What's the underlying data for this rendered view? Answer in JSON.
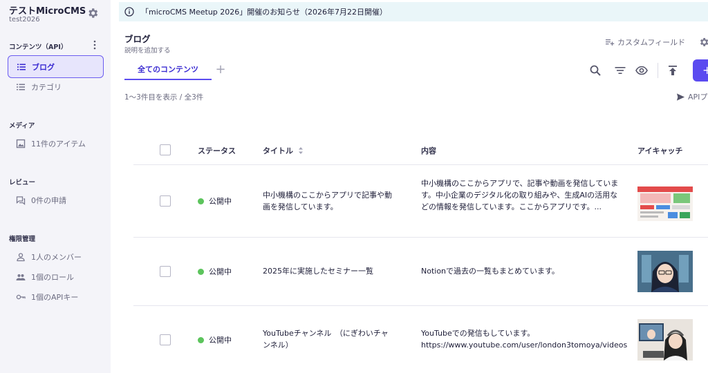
{
  "sidebar": {
    "app_name": "テストMicroCMS",
    "app_id": "test2026",
    "sections": {
      "contents": "コンテンツ（API）",
      "media": "メディア",
      "review": "レビュー",
      "permissions": "権限管理"
    },
    "items": {
      "blog": "ブログ",
      "category": "カテゴリ",
      "media": "11件のアイテム",
      "review": "0件の申請",
      "members": "1人のメンバー",
      "roles": "1個のロール",
      "api_keys": "1個のAPIキー"
    }
  },
  "banner": {
    "text": "「microCMS Meetup 2026」開催のお知らせ（2026年7月22日開催）"
  },
  "header": {
    "title": "ブログ",
    "description": "説明を追加する",
    "custom_field": "カスタムフィールド",
    "tab": "全てのコンテンツ",
    "tab_add": "+",
    "add_button": "+"
  },
  "list": {
    "count": "1〜3件目を表示 / 全3件",
    "api_preview": "APIプ",
    "columns": {
      "status": "ステータス",
      "title": "タイトル",
      "content": "内容",
      "eyecatch": "アイキャッチ"
    },
    "rows": [
      {
        "status": "公開中",
        "title": "中小機構のここからアプリで記事や動画を発信しています。",
        "content": "中小機構のここからアプリで、記事や動画を発信しています。中小企業のデジタル化の取り組みや、生成AIの活用などの情報を発信しています。ここからアプリです。..."
      },
      {
        "status": "公開中",
        "title": "2025年に実施したセミナー一覧",
        "content": "Notionで過去の一覧もまとめています。"
      },
      {
        "status": "公開中",
        "title": "YouTubeチャンネル　（にぎわいチャンネル）",
        "content": "YouTubeでの発信もしています。 https://www.youtube.com/user/london3tomoya/videos"
      }
    ]
  },
  "colors": {
    "accent": "#5b4bf0",
    "published": "#5cc45c",
    "sidebar_bg": "#f4f4f9",
    "banner_bg": "#eaf6f9"
  }
}
